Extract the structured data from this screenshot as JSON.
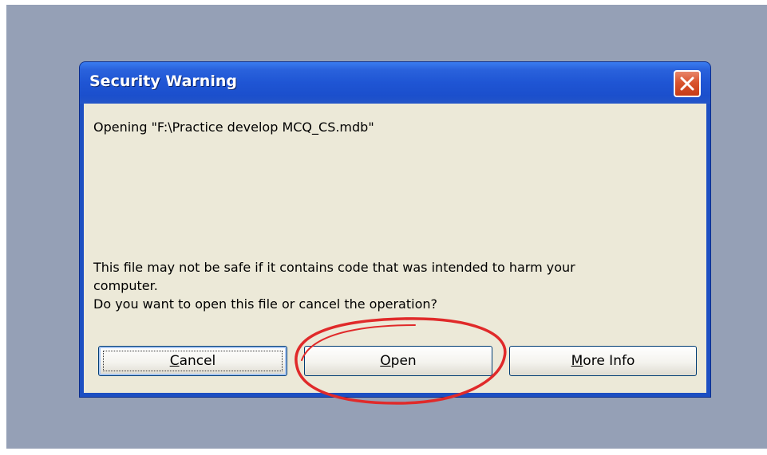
{
  "dialog": {
    "title": "Security Warning",
    "close_icon": "close-x-icon",
    "opening_text": "Opening \"F:\\Practice develop MCQ_CS.mdb\"",
    "warning_line1": "This file may not be safe if it contains code that was intended to harm your",
    "warning_line2": "computer.",
    "question": "Do you want to open this file or cancel the operation?",
    "buttons": {
      "cancel": {
        "accel": "C",
        "rest": "ancel"
      },
      "open": {
        "accel": "O",
        "rest": "pen"
      },
      "more_info": {
        "accel": "M",
        "rest": "ore Info"
      }
    }
  },
  "colors": {
    "desktop": "#95a0b6",
    "title_bar": "#1f55d4",
    "dialog_face": "#ece9d8",
    "close_button": "#d9542f",
    "annotation_ellipse": "#e02a2a"
  },
  "annotation": {
    "type": "hand-drawn ellipse",
    "target": "open-button"
  }
}
